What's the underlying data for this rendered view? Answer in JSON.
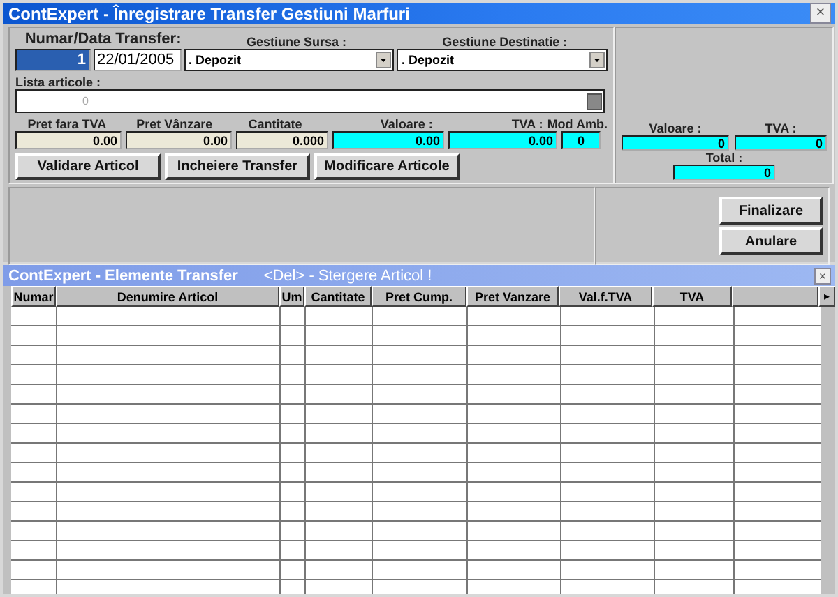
{
  "window": {
    "title": "ContExpert - Înregistrare Transfer Gestiuni Marfuri",
    "close": "×"
  },
  "header": {
    "number_label": "Numar/Data Transfer:",
    "number": "1",
    "date": "22/01/2005",
    "source_label": "Gestiune Sursa :",
    "source": ". Depozit",
    "destination_label": "Gestiune Destinatie :",
    "destination": ". Depozit"
  },
  "articles": {
    "label": "Lista articole :",
    "placeholder": "0"
  },
  "item_fields": [
    {
      "label": "Pret fara TVA",
      "value": "0.00",
      "kind": "plain"
    },
    {
      "label": "Pret Vânzare",
      "value": "0.00",
      "kind": "plain"
    },
    {
      "label": "Cantitate",
      "value": "0.000",
      "kind": "plain"
    },
    {
      "label": "Valoare :",
      "value": "0.00",
      "kind": "computed"
    },
    {
      "label": "TVA :",
      "value": "0.00",
      "kind": "computed"
    },
    {
      "label": "Mod Amb.",
      "value": "0",
      "kind": "computed"
    }
  ],
  "item_buttons": [
    "Validare Articol",
    "Incheiere Transfer",
    "Modificare Articole"
  ],
  "totals": {
    "value_label": "Valoare :",
    "value": "0",
    "vat_label": "TVA :",
    "vat": "0",
    "total_label": "Total :",
    "total": "0"
  },
  "actions": [
    "Finalizare",
    "Anulare"
  ],
  "grid_window": {
    "title": "ContExpert - Elemente Transfer",
    "hint": "<Del> - Stergere Articol !",
    "close": "×"
  },
  "table": {
    "columns": [
      "Numar",
      "Denumire Articol",
      "Um",
      "Cantitate",
      "Pret Cump.",
      "Pret Vanzare",
      "Val.f.TVA",
      "TVA"
    ],
    "scroll": "▸"
  }
}
